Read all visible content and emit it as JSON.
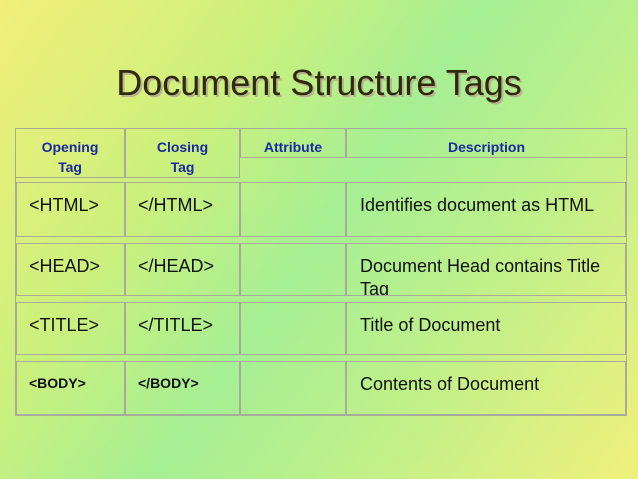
{
  "title": "Document Structure Tags",
  "table": {
    "headers": {
      "opening": "Opening\nTag",
      "closing": "Closing\nTag",
      "attribute": "Attribute",
      "description": "Description"
    },
    "rows": [
      {
        "opening": "<HTML>",
        "closing": "</HTML>",
        "attribute": "",
        "description": "Identifies document as HTML"
      },
      {
        "opening": "<HEAD>",
        "closing": "</HEAD>",
        "attribute": "",
        "description": "Document Head contains Title Tag"
      },
      {
        "opening": "<TITLE>",
        "closing": "</TITLE>",
        "attribute": "",
        "description": "Title of Document"
      },
      {
        "opening": "<BODY>",
        "closing": "</BODY>",
        "attribute": "",
        "description": "Contents of Document"
      }
    ]
  }
}
